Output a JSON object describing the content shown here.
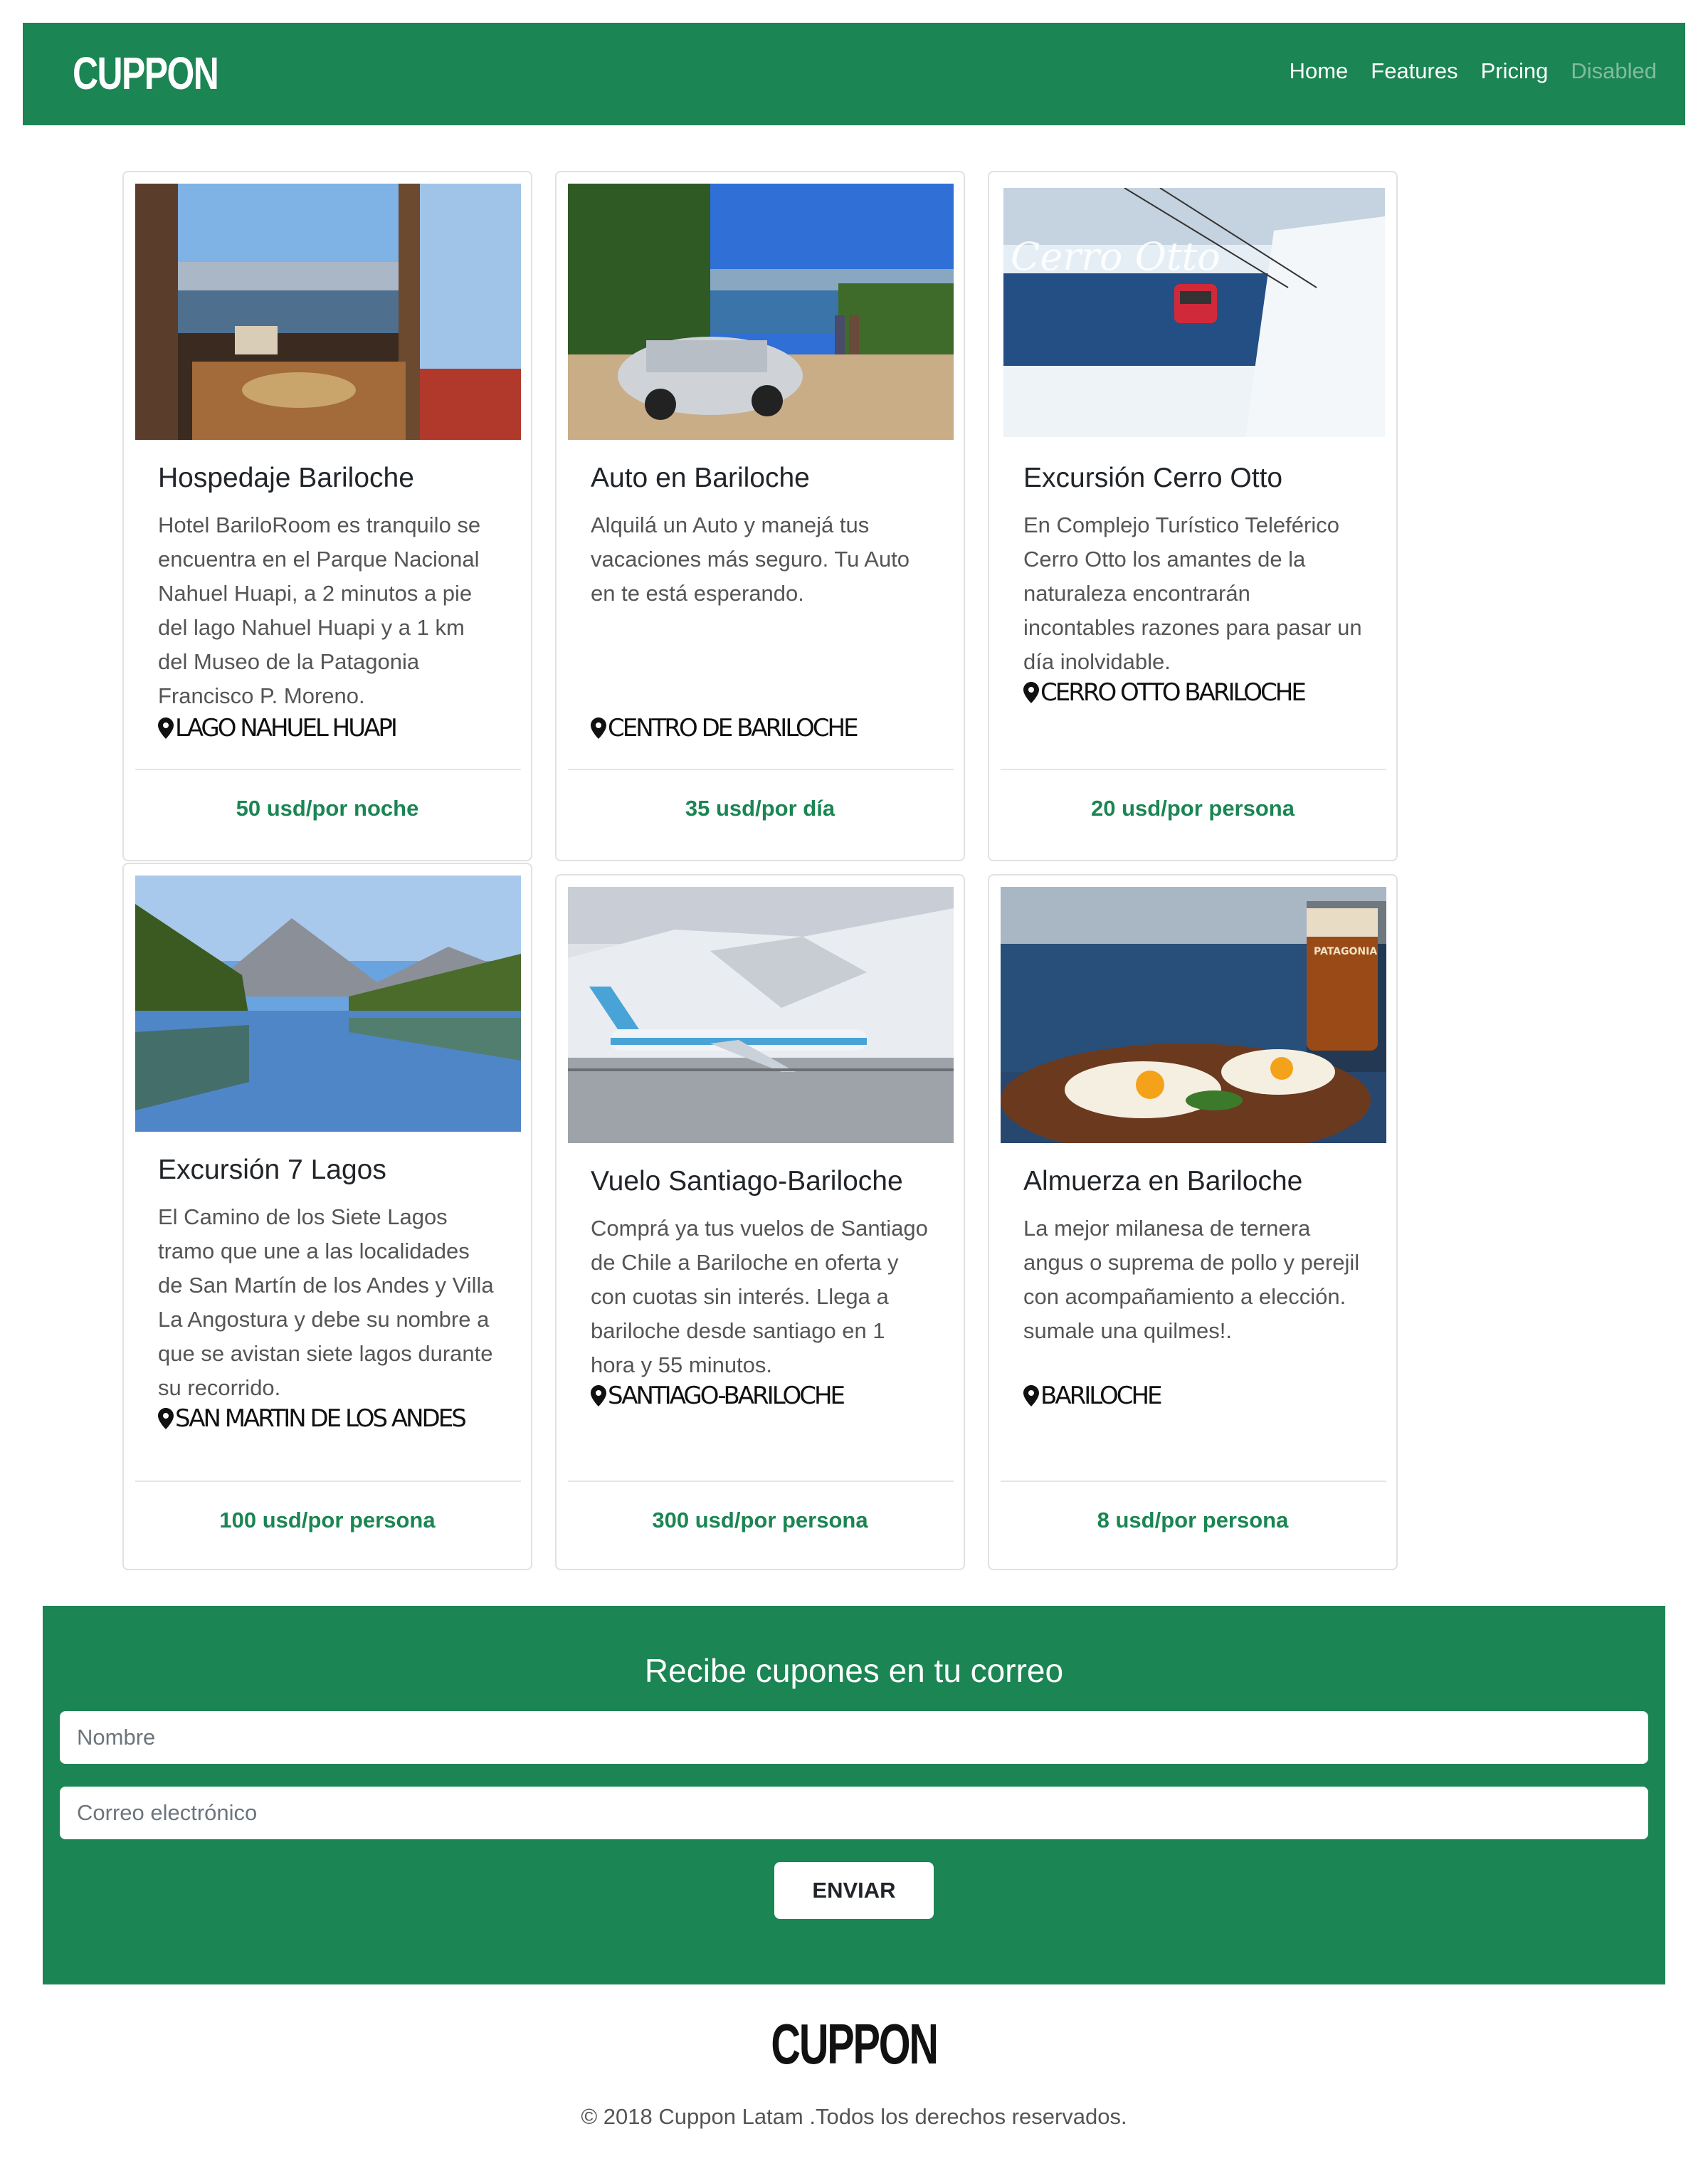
{
  "brand": "CUPPON",
  "nav": {
    "links": [
      "Home",
      "Features",
      "Pricing",
      "Disabled"
    ]
  },
  "cards": [
    {
      "title": "Hospedaje Bariloche",
      "text": "Hotel BariloRoom es tranquilo se encuentra en el Parque Nacional Nahuel Huapi, a 2 minutos a pie del lago Nahuel Huapi y a 1 km del Museo de la Patagonia Francisco P. Moreno.",
      "location": "LAGO NAHUEL HUAPI",
      "price": "50 usd/por noche",
      "image": "hotel-lake-view"
    },
    {
      "title": "Auto en Bariloche",
      "text": "Alquilá un Auto y manejá tus vacaciones más seguro. Tu Auto en te está esperando.",
      "location": "CENTRO DE BARILOCHE",
      "price": "35 usd/por día",
      "image": "car-lake-view"
    },
    {
      "title": "Excursión Cerro Otto",
      "text": "En Complejo Turístico Teleférico Cerro Otto los amantes de la naturaleza encontrarán incontables razones para pasar un día inolvidable.",
      "location": "CERRO OTTO BARILOCHE",
      "price": "20 usd/por persona",
      "image": "cable-car",
      "image_caption": "Cerro Otto"
    },
    {
      "title": "Excursión 7 Lagos",
      "text": "El Camino de los Siete Lagos tramo que une a las localidades de San Martín de los Andes y Villa La Angostura y debe su nombre a que se avistan siete lagos durante su recorrido.",
      "location": "SAN MARTIN DE LOS ANDES",
      "price": "100 usd/por persona",
      "image": "mountain-lake"
    },
    {
      "title": "Vuelo Santiago-Bariloche",
      "text": "Comprá ya tus vuelos de Santiago de Chile a Bariloche en oferta y con cuotas sin interés. Llega a bariloche desde santiago en 1 hora y 55 minutos.",
      "location": "SANTIAGO-BARILOCHE",
      "price": "300 usd/por persona",
      "image": "airplane"
    },
    {
      "title": "Almuerza en Bariloche",
      "text": "La mejor milanesa de ternera angus o suprema de pollo y perejil con acompañamiento a elección. sumale una quilmes!.",
      "location": "BARILOCHE",
      "price": "8 usd/por persona",
      "image": "food-beer",
      "image_caption": "PATAGONIA"
    }
  ],
  "subscribe": {
    "title": "Recibe cupones en tu correo",
    "name_placeholder": "Nombre",
    "email_placeholder": "Correo electrónico",
    "button": "ENVIAR"
  },
  "footer": {
    "brand": "CUPPON",
    "copyright": "© 2018 Cuppon Latam .Todos los derechos reservados."
  },
  "colors": {
    "brand_green": "#1b8553",
    "card_border": "#dee2e6"
  }
}
